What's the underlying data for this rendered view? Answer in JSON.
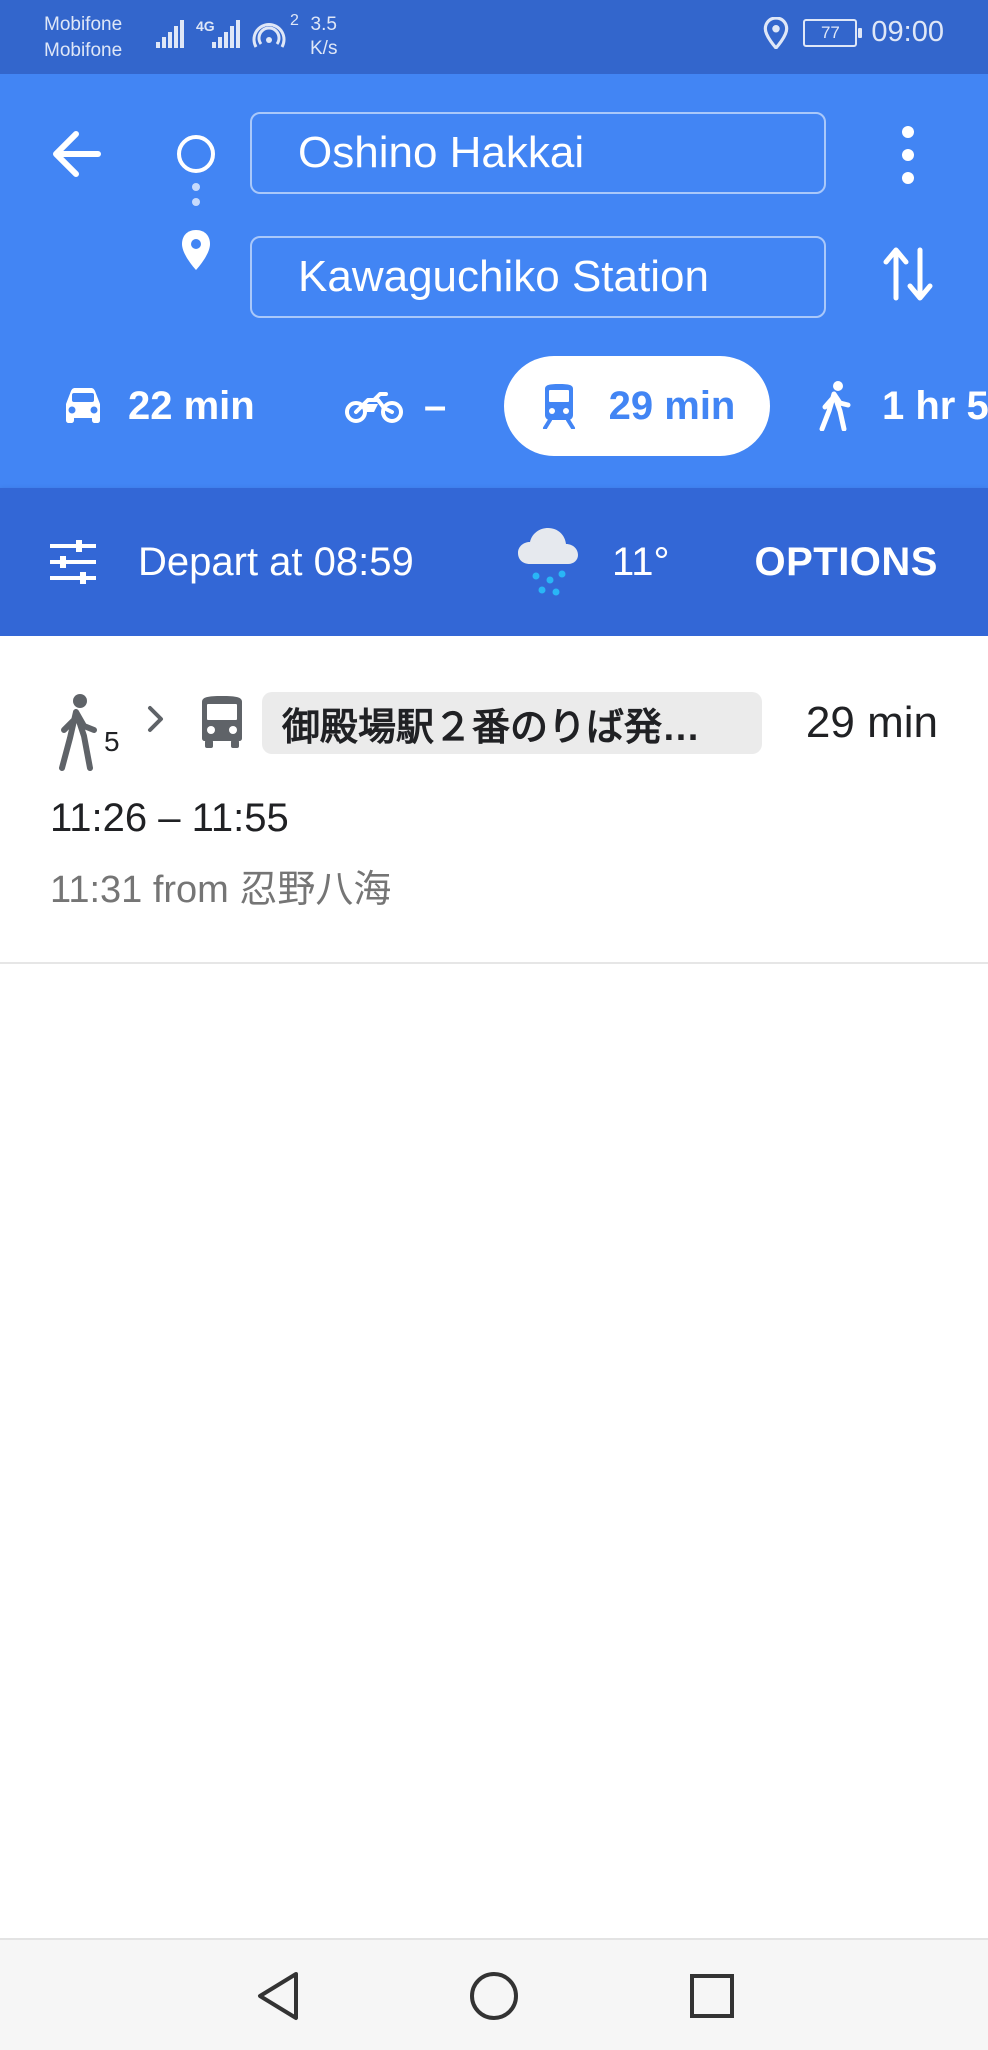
{
  "status_bar": {
    "carrier_1": "Mobifone",
    "carrier_2": "Mobifone",
    "network_1": "4G",
    "hotspot_count": "2",
    "speed_value": "3.5",
    "speed_unit": "K/s",
    "battery": "77",
    "time": "09:00"
  },
  "directions": {
    "origin": "Oshino Hakkai",
    "destination": "Kawaguchiko Station"
  },
  "modes": [
    {
      "name": "driving",
      "label": "22 min",
      "icon": "car-icon"
    },
    {
      "name": "motorcycle",
      "label": "–",
      "icon": "motorcycle-icon"
    },
    {
      "name": "transit",
      "label": "29 min",
      "icon": "train-icon",
      "selected": true
    },
    {
      "name": "walking",
      "label": "1 hr 5",
      "icon": "walk-icon"
    }
  ],
  "options_bar": {
    "depart": "Depart at 08:59",
    "temperature": "11°",
    "options_label": "OPTIONS",
    "weather_icon": "rain-cloud-icon"
  },
  "route": {
    "walk_minutes": "5",
    "line_name": "御殿場駅２番のりば発…",
    "duration": "29 min",
    "times": "11:26 – 11:55",
    "departure": "11:31 from 忍野八海"
  },
  "colors": {
    "status_bar": "#3366cc",
    "header": "#4285f4",
    "options_bar": "#3367d6",
    "accent": "#4285f4"
  }
}
